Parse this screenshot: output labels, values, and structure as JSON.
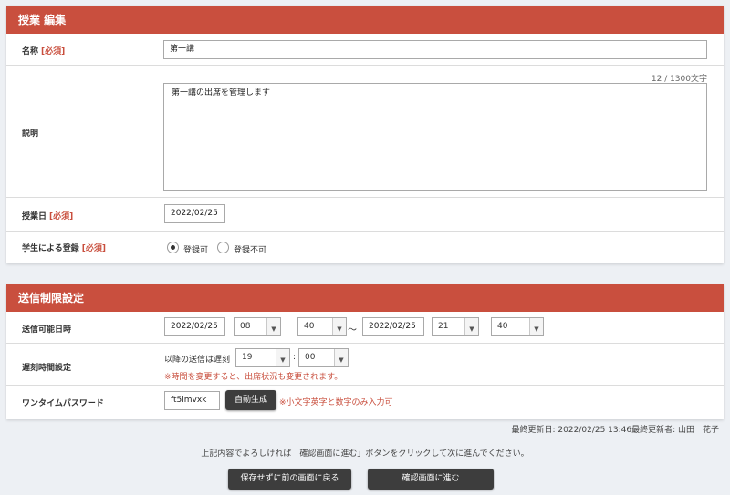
{
  "lesson_panel": {
    "title": "授業 編集",
    "name_label": "名称",
    "required": "[必須]",
    "name_value": "第一講",
    "char_count": "12 / 1300文字",
    "description_label": "説明",
    "description_value": "第一講の出席を管理します",
    "date_label": "授業日",
    "date_value": "2022/02/25",
    "student_reg_label": "学生による登録",
    "reg_allowed": "登録可",
    "reg_not_allowed": "登録不可"
  },
  "send_panel": {
    "title": "送信制限設定",
    "period_label": "送信可能日時",
    "start_date": "2022/02/25",
    "start_hour": "08",
    "start_min": "40",
    "tilde": "～",
    "end_date": "2022/02/25",
    "end_hour": "21",
    "end_min": "40",
    "colon": ":",
    "late_label": "遅刻時間設定",
    "late_prefix": "以降の送信は遅刻",
    "late_hour": "19",
    "late_min": "00",
    "late_note": "※時間を変更すると、出席状況も変更されます。",
    "otp_label": "ワンタイムパスワード",
    "otp_value": "ft5imvxk",
    "auto_gen": "自動生成",
    "otp_note": "※小文字英字と数字のみ入力可"
  },
  "footer": {
    "last_updated": "最終更新日: 2022/02/25 13:46最終更新者: 山田　花子",
    "instruction": "上記内容でよろしければ「確認画面に進む」ボタンをクリックして次に進んでください。",
    "back_button": "保存せずに前の画面に戻る",
    "confirm_button": "確認画面に進む"
  },
  "icons": {
    "dropdown": "chevron-down-icon"
  },
  "colors": {
    "accent": "#c94f3e",
    "button": "#3d3d3d",
    "background": "#edf0f4"
  }
}
